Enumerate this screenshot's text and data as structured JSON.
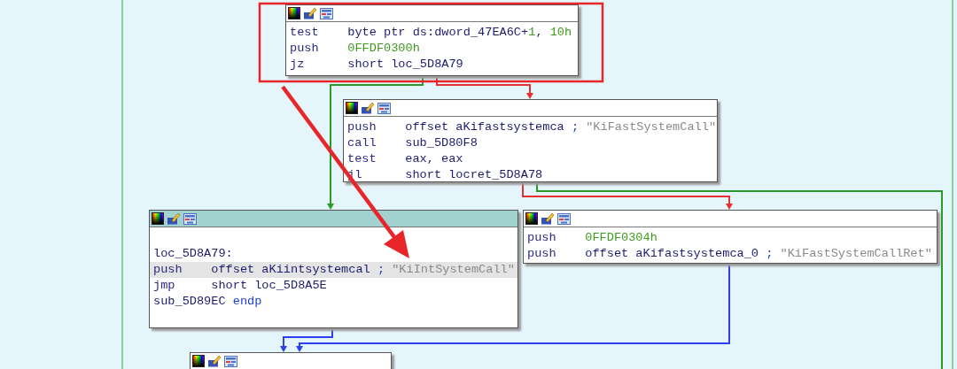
{
  "graph": {
    "nodes": [
      {
        "selected": false,
        "lines": [
          {
            "highlighted": false,
            "parts": [
              {
                "kind": "mnemonic",
                "text": "test"
              },
              {
                "kind": "text",
                "text": "byte ptr ds:dword_47EA6C+"
              },
              {
                "kind": "number",
                "text": "1"
              },
              {
                "kind": "text",
                "text": ", "
              },
              {
                "kind": "number",
                "text": "10h"
              }
            ]
          },
          {
            "highlighted": false,
            "parts": [
              {
                "kind": "mnemonic",
                "text": "push"
              },
              {
                "kind": "number",
                "text": "0FFDF0300h"
              }
            ]
          },
          {
            "highlighted": false,
            "parts": [
              {
                "kind": "mnemonic",
                "text": "jz"
              },
              {
                "kind": "text",
                "text": "short loc_5D8A79"
              }
            ]
          }
        ]
      },
      {
        "selected": false,
        "lines": [
          {
            "highlighted": false,
            "parts": [
              {
                "kind": "mnemonic",
                "text": "push"
              },
              {
                "kind": "text",
                "text": "offset aKifastsystemca "
              },
              {
                "kind": "keyword",
                "text": ";"
              },
              {
                "kind": "comment",
                "text": " \"KiFastSystemCall\""
              }
            ]
          },
          {
            "highlighted": false,
            "parts": [
              {
                "kind": "mnemonic",
                "text": "call"
              },
              {
                "kind": "text",
                "text": "sub_5D80F8"
              }
            ]
          },
          {
            "highlighted": false,
            "parts": [
              {
                "kind": "mnemonic",
                "text": "test"
              },
              {
                "kind": "text",
                "text": "eax, eax"
              }
            ]
          },
          {
            "highlighted": false,
            "parts": [
              {
                "kind": "mnemonic",
                "text": "jl"
              },
              {
                "kind": "text",
                "text": "short locret_5D8A78"
              }
            ]
          }
        ]
      },
      {
        "selected": true,
        "lines": [
          {
            "highlighted": false,
            "parts": [
              {
                "kind": "text",
                "text": "loc_5D8A79:"
              }
            ]
          },
          {
            "highlighted": true,
            "parts": [
              {
                "kind": "mnemonic",
                "text": "push"
              },
              {
                "kind": "text",
                "text": "offset aKiintsystemcal "
              },
              {
                "kind": "keyword",
                "text": ";"
              },
              {
                "kind": "comment",
                "text": " \"KiIntSystemCall\""
              }
            ]
          },
          {
            "highlighted": false,
            "parts": [
              {
                "kind": "mnemonic",
                "text": "jmp"
              },
              {
                "kind": "text",
                "text": "short loc_5D8A5E"
              }
            ]
          },
          {
            "highlighted": false,
            "parts": [
              {
                "kind": "text",
                "text": "sub_5D89EC "
              },
              {
                "kind": "keyword",
                "text": "endp"
              }
            ]
          }
        ]
      },
      {
        "selected": false,
        "lines": [
          {
            "highlighted": false,
            "parts": [
              {
                "kind": "mnemonic",
                "text": "push"
              },
              {
                "kind": "number",
                "text": "0FFDF0304h"
              }
            ]
          },
          {
            "highlighted": false,
            "parts": [
              {
                "kind": "mnemonic",
                "text": "push"
              },
              {
                "kind": "text",
                "text": "offset aKifastsystemca_0 "
              },
              {
                "kind": "keyword",
                "text": ";"
              },
              {
                "kind": "comment",
                "text": " \"KiFastSystemCallRet\""
              }
            ]
          }
        ]
      },
      {
        "selected": false
      }
    ],
    "edges": [
      {
        "color": "#2a9a2a"
      },
      {
        "color": "#e83030"
      },
      {
        "color": "#e83030"
      },
      {
        "color": "#2a9a2a"
      },
      {
        "color": "#2e3ff0"
      },
      {
        "color": "#2e3ff0"
      }
    ]
  }
}
